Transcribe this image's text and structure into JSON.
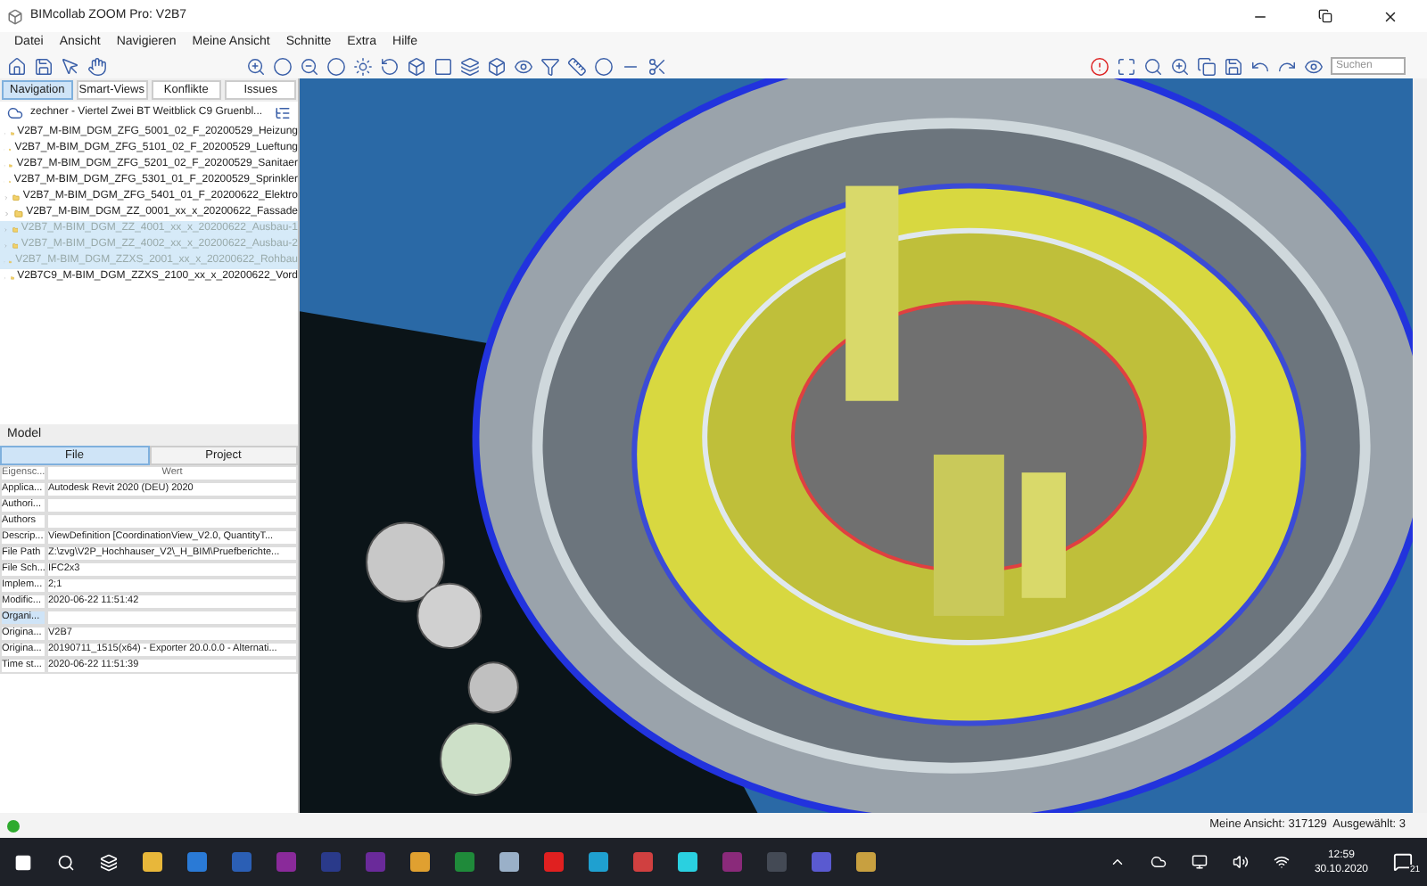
{
  "window": {
    "title": "BIMcollab ZOOM Pro: V2B7"
  },
  "menu": [
    "Datei",
    "Ansicht",
    "Navigieren",
    "Meine Ansicht",
    "Schnitte",
    "Extra",
    "Hilfe"
  ],
  "search": {
    "placeholder": "Suchen"
  },
  "nav_tabs": [
    {
      "label": "Navigation",
      "selected": true
    },
    {
      "label": "Smart-Views",
      "selected": false
    },
    {
      "label": "Konflikte",
      "selected": false
    },
    {
      "label": "Issues",
      "selected": false
    }
  ],
  "tree": {
    "root": "zechner - Viertel Zwei BT Weitblick C9 Gruenbl...",
    "items": [
      {
        "label": "V2B7_M-BIM_DGM_ZFG_5001_02_F_20200529_Heizung",
        "selected": false
      },
      {
        "label": "V2B7_M-BIM_DGM_ZFG_5101_02_F_20200529_Lueftung",
        "selected": false
      },
      {
        "label": "V2B7_M-BIM_DGM_ZFG_5201_02_F_20200529_Sanitaer",
        "selected": false
      },
      {
        "label": "V2B7_M-BIM_DGM_ZFG_5301_01_F_20200529_Sprinkler",
        "selected": false
      },
      {
        "label": "V2B7_M-BIM_DGM_ZFG_5401_01_F_20200622_Elektro",
        "selected": false
      },
      {
        "label": "V2B7_M-BIM_DGM_ZZ_0001_xx_x_20200622_Fassade",
        "selected": false
      },
      {
        "label": "V2B7_M-BIM_DGM_ZZ_4001_xx_x_20200622_Ausbau-1",
        "selected": true
      },
      {
        "label": "V2B7_M-BIM_DGM_ZZ_4002_xx_x_20200622_Ausbau-2",
        "selected": true
      },
      {
        "label": "V2B7_M-BIM_DGM_ZZXS_2001_xx_x_20200622_Rohbau",
        "selected": true
      },
      {
        "label": "V2B7C9_M-BIM_DGM_ZZXS_2100_xx_x_20200622_Vord",
        "selected": false
      }
    ]
  },
  "model": {
    "title": "Model",
    "tabs": [
      {
        "label": "File",
        "selected": true
      },
      {
        "label": "Project",
        "selected": false
      }
    ],
    "columns": [
      "Eigensc...",
      "Wert"
    ],
    "rows": [
      {
        "key": "Applica...",
        "value": "Autodesk Revit 2020 (DEU) 2020",
        "selected": false
      },
      {
        "key": "Authori...",
        "selected": false
      },
      {
        "key": "Authors",
        "selected": false
      },
      {
        "key": "Descrip...",
        "value": "ViewDefinition [CoordinationView_V2.0, QuantityT...",
        "selected": false
      },
      {
        "key": "File Path",
        "value": "Z:\\zvg\\V2P_Hochhauser_V2\\_H_BIM\\Pruefberichte...",
        "selected": false
      },
      {
        "key": "File Sch...",
        "value": "IFC2x3",
        "selected": false
      },
      {
        "key": "Implem...",
        "value": "2;1",
        "selected": false
      },
      {
        "key": "Modific...",
        "value": "2020-06-22 11:51:42",
        "selected": false
      },
      {
        "key": "Organi...",
        "selected": true
      },
      {
        "key": "Origina...",
        "value": "V2B7",
        "selected": false
      },
      {
        "key": "Origina...",
        "value": "20190711_1515(x64) - Exporter 20.0.0.0 - Alternati...",
        "selected": false
      },
      {
        "key": "Time st...",
        "value": "2020-06-22 11:51:39",
        "selected": false
      }
    ]
  },
  "status_bar": {
    "text": "Meine Ansicht: 317129  Ausgewählt: 3"
  },
  "taskbar": {
    "time": "12:59",
    "date": "30.10.2020",
    "notifications": "21"
  }
}
